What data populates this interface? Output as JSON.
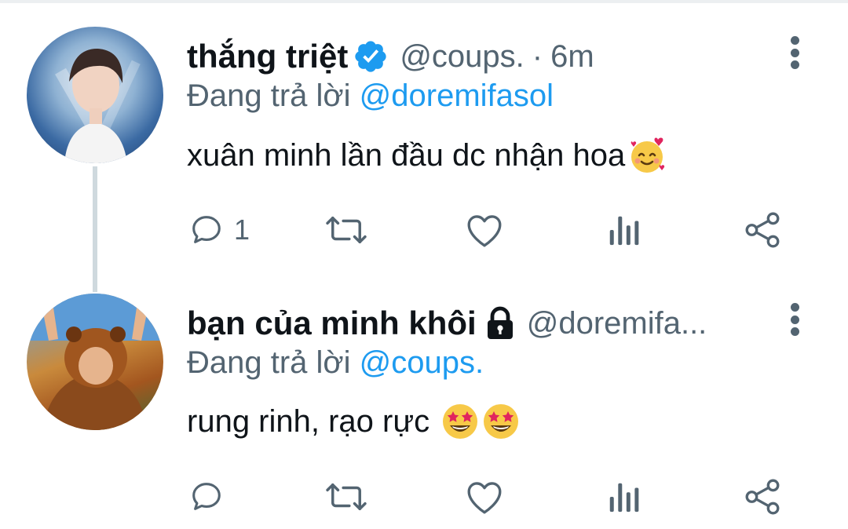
{
  "tweets": [
    {
      "display_name": "thắng triệt",
      "handle": "@coups.",
      "separator": "·",
      "time": "6m",
      "reply_prefix": "Đang trả lời",
      "reply_to": "@doremifasol",
      "text": "xuân minh lần đầu dc nhận hoa",
      "emoji": "smiling-face-with-hearts",
      "reply_count": "1",
      "verified": true
    },
    {
      "display_name": "bạn của minh khôi",
      "handle": "@doremifa...",
      "reply_prefix": "Đang trả lời",
      "reply_to": "@coups.",
      "text": "rung rinh, rạo rực",
      "emoji": "star-struck",
      "locked": true
    }
  ],
  "colors": {
    "accent": "#1d9bf0",
    "secondary_text": "#536471",
    "primary_text": "#0f1419",
    "thread_line": "#cfd9de"
  }
}
